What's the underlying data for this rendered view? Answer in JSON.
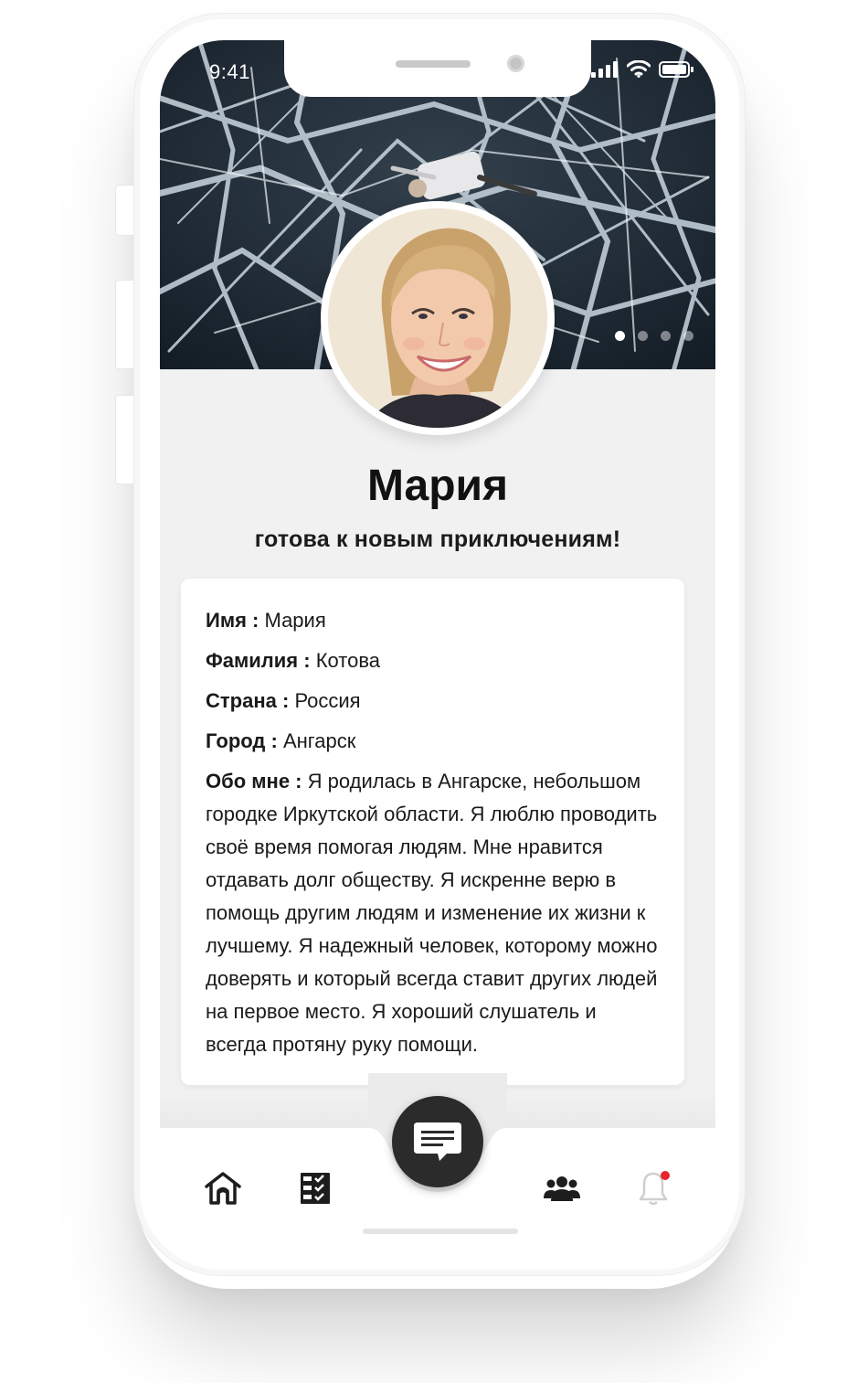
{
  "status_bar": {
    "time": "9:41"
  },
  "cover": {
    "dots_total": 4,
    "active_dot": 0
  },
  "profile": {
    "name": "Мария",
    "tagline": "готова к новым приключениям!"
  },
  "details": {
    "first_name_label": "Имя :",
    "first_name_value": "Мария",
    "last_name_label": "Фамилия :",
    "last_name_value": "Котова",
    "country_label": "Страна :",
    "country_value": "Россия",
    "city_label": "Город :",
    "city_value": "Ангарск",
    "about_label": "Обо мне :",
    "about_value": "Я родилась в Ангарске, небольшом городке Иркутской области. Я люблю проводить своё время помогая людям. Мне нравится отдавать долг обществу. Я искренне верю в помощь другим людям и изменение их жизни к лучшему. Я надежный человек, которому можно доверять и который всегда ставит других людей на первое место. Я хороший слушатель и всегда протяну руку помощи."
  },
  "nav": {
    "items": [
      {
        "icon": "home-icon"
      },
      {
        "icon": "checklist-icon"
      },
      {
        "icon": "chat-icon"
      },
      {
        "icon": "group-icon"
      },
      {
        "icon": "bell-icon",
        "badge": true
      }
    ],
    "badge_color": "#e8232b"
  }
}
